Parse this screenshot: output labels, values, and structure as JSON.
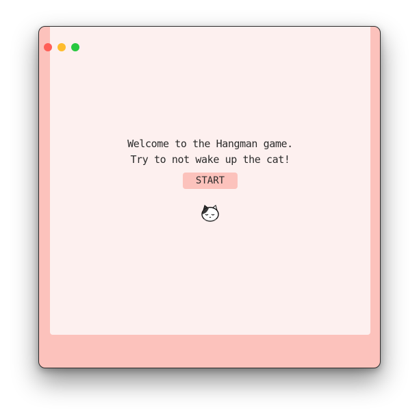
{
  "window": {
    "controls": [
      "close",
      "minimize",
      "maximize"
    ]
  },
  "game": {
    "welcome_line1": "Welcome to the Hangman game.",
    "welcome_line2": "Try to not wake up the cat!",
    "start_label": "START",
    "cat_icon": "sleeping-cat-icon"
  },
  "colors": {
    "frame": "#fcc2bc",
    "panel": "#fdf0ef",
    "button": "#fcc2bc",
    "text": "#2a2a2a"
  }
}
